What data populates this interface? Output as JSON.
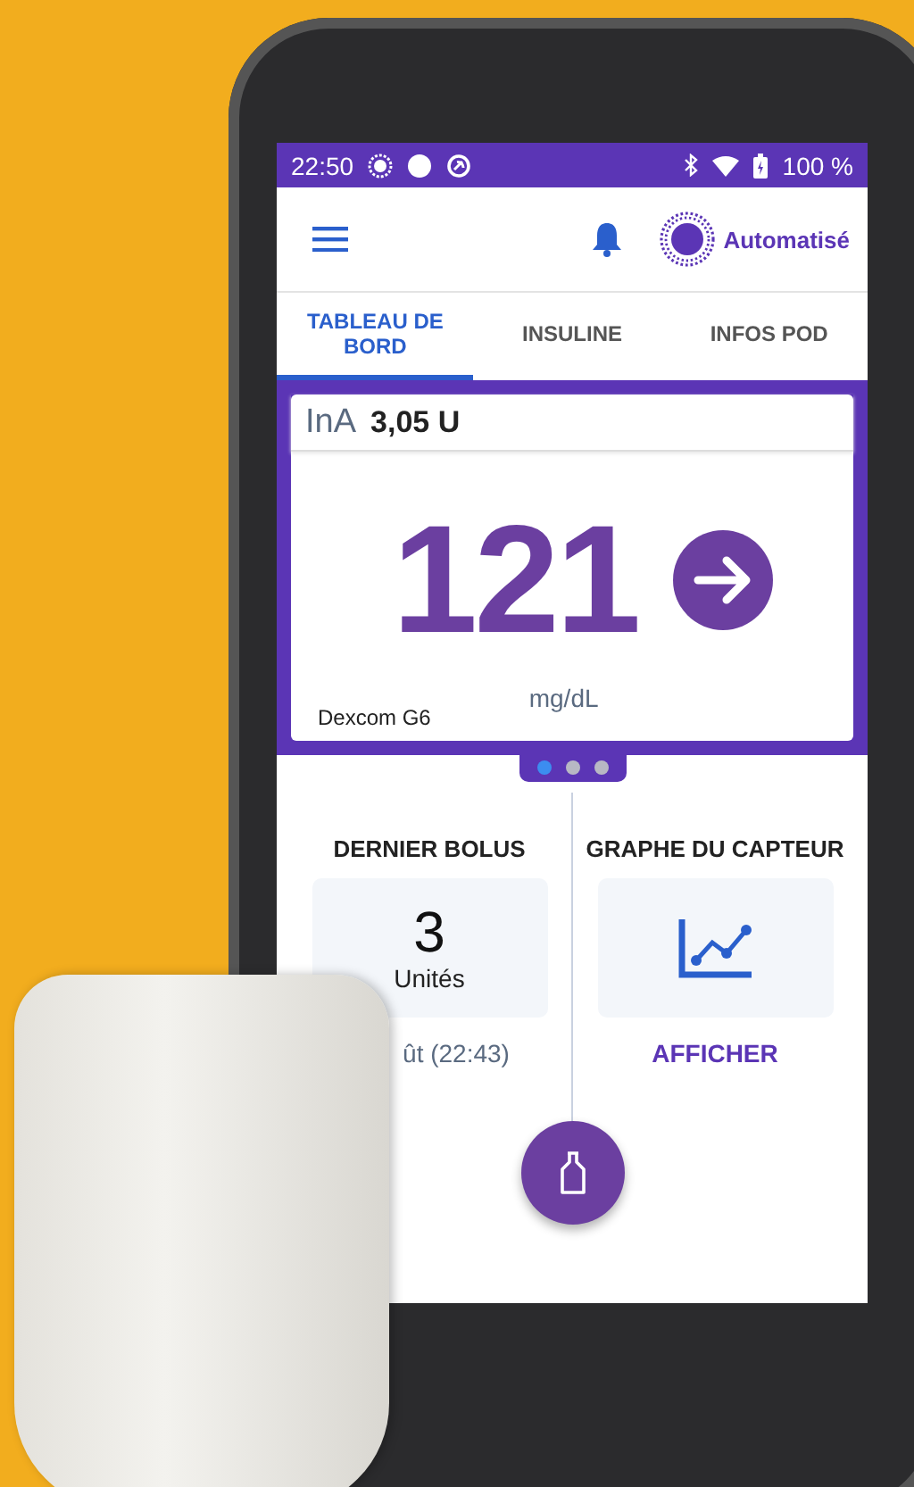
{
  "status_bar": {
    "time": "22:50",
    "battery": "100 %"
  },
  "header": {
    "mode": "Automatisé"
  },
  "tabs": [
    {
      "label": "TABLEAU DE BORD",
      "selected": true
    },
    {
      "label": "INSULINE",
      "selected": false
    },
    {
      "label": "INFOS POD",
      "selected": false
    }
  ],
  "glucose_card": {
    "iob_label": "InA",
    "iob_value": "3,05 U",
    "value": "121",
    "unit": "mg/dL",
    "sensor": "Dexcom G6"
  },
  "pager": [
    {
      "selected": true
    },
    {
      "selected": false
    },
    {
      "selected": false
    }
  ],
  "last_bolus": {
    "title": "DERNIER BOLUS",
    "value": "3",
    "unit": "Unités",
    "time": "ût (22:43)"
  },
  "sensor_graph": {
    "title": "GRAPHE DU CAPTEUR",
    "link": "AFFICHER"
  }
}
